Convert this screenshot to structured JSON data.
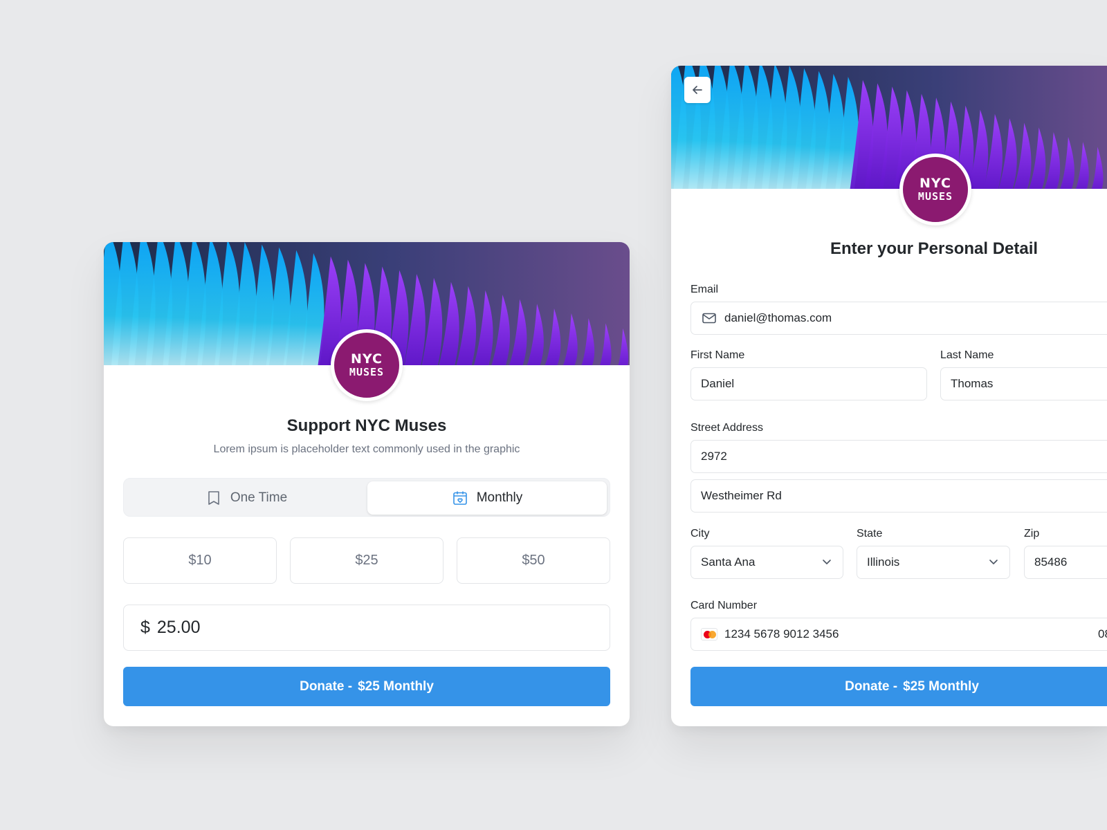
{
  "colors": {
    "background": "#e8e9eb",
    "primary_button": "#3593e8",
    "logo_circle": "#8b1a70",
    "monthly_icon": "#3593e8"
  },
  "logo": {
    "line1": "NYC",
    "line2": "MUSES"
  },
  "donation_card": {
    "title": "Support NYC Muses",
    "subtitle": "Lorem ipsum is placeholder text commonly used in the graphic",
    "frequency": {
      "options": [
        {
          "label": "One Time",
          "icon": "receipt-icon",
          "selected": false
        },
        {
          "label": "Monthly",
          "icon": "calendar-heart-icon",
          "selected": true
        }
      ]
    },
    "amounts": [
      "$10",
      "$25",
      "$50"
    ],
    "amount_input": {
      "currency": "$",
      "value": "25.00"
    },
    "donate_button": {
      "prefix": "Donate -",
      "amount": "$25 Monthly"
    }
  },
  "details_card": {
    "back_icon": "arrow-left-icon",
    "title": "Enter your Personal Detail",
    "email": {
      "label": "Email",
      "value": "daniel@thomas.com",
      "icon": "mail-icon"
    },
    "first_name": {
      "label": "First Name",
      "value": "Daniel"
    },
    "last_name": {
      "label": "Last Name",
      "value": "Thomas"
    },
    "street": {
      "label": "Street Address",
      "line1": "2972",
      "line2": "Westheimer Rd"
    },
    "city": {
      "label": "City",
      "value": "Santa Ana"
    },
    "state": {
      "label": "State",
      "value": "Illinois"
    },
    "zip": {
      "label": "Zip",
      "value": "85486"
    },
    "card": {
      "label": "Card Number",
      "value": "1234 5678 9012 3456",
      "expiry_partial": "08",
      "icon": "mastercard-icon"
    },
    "donate_button": {
      "prefix": "Donate -",
      "amount": "$25 Monthly"
    }
  }
}
